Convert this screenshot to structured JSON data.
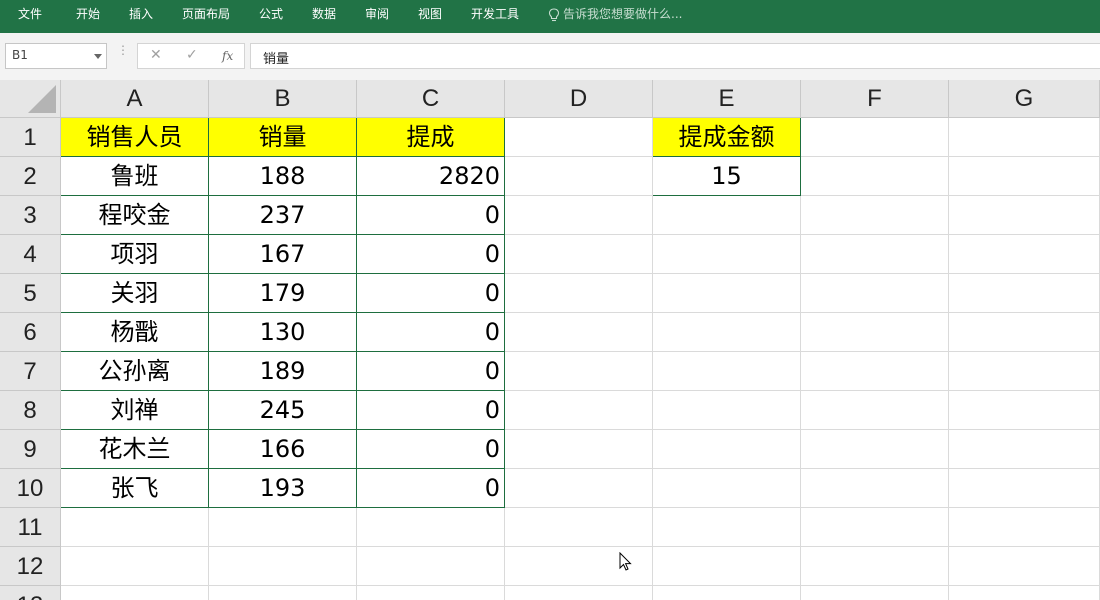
{
  "ribbon": {
    "tabs": [
      "文件",
      "开始",
      "插入",
      "页面布局",
      "公式",
      "数据",
      "审阅",
      "视图",
      "开发工具"
    ],
    "tell_me": "告诉我您想要做什么..."
  },
  "formula_bar": {
    "name_box": "B1",
    "fx_label": "fx",
    "value": "销量"
  },
  "sheet": {
    "columns": [
      "A",
      "B",
      "C",
      "D",
      "E",
      "F",
      "G"
    ],
    "rows": [
      "1",
      "2",
      "3",
      "4",
      "5",
      "6",
      "7",
      "8",
      "9",
      "10",
      "11",
      "12",
      "13"
    ],
    "headers": {
      "salesperson": "销售人员",
      "sales": "销量",
      "commission": "提成",
      "commission_amount": "提成金额"
    },
    "records": [
      {
        "name": "鲁班",
        "sales": "188",
        "commission": "2820"
      },
      {
        "name": "程咬金",
        "sales": "237",
        "commission": "0"
      },
      {
        "name": "项羽",
        "sales": "167",
        "commission": "0"
      },
      {
        "name": "关羽",
        "sales": "179",
        "commission": "0"
      },
      {
        "name": "杨戬",
        "sales": "130",
        "commission": "0"
      },
      {
        "name": "公孙离",
        "sales": "189",
        "commission": "0"
      },
      {
        "name": "刘禅",
        "sales": "245",
        "commission": "0"
      },
      {
        "name": "花木兰",
        "sales": "166",
        "commission": "0"
      },
      {
        "name": "张飞",
        "sales": "193",
        "commission": "0"
      }
    ],
    "commission_amount_value": "15"
  },
  "colors": {
    "ribbon": "#217346",
    "header_fill": "#ffff00",
    "table_border": "#1e6e3f"
  }
}
